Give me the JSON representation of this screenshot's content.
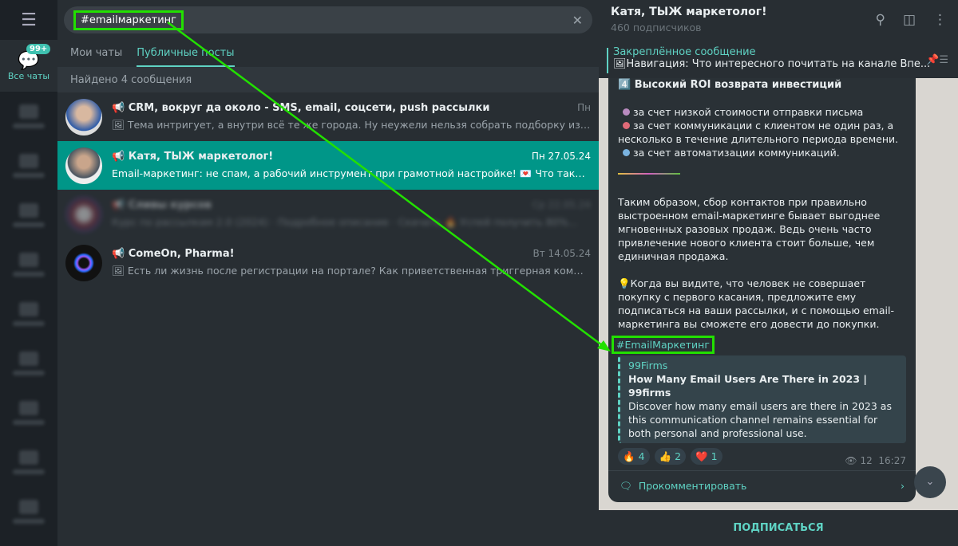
{
  "sidebar": {
    "all_chats_label": "Все чаты",
    "badge": "99+"
  },
  "search": {
    "query": "#emailмаркетинг"
  },
  "tabs": [
    {
      "label": "Мои чаты"
    },
    {
      "label": "Публичные посты"
    }
  ],
  "found": "Найдено 4 сообщения",
  "results": [
    {
      "title": "📢 CRM, вокруг да около - SMS, email, соцсети, push рассылки",
      "date": "Пн",
      "preview": "🖼 Тема интригует, а внутри всё те же города.   Ну неужели нельзя собрать подборку из чего-т..."
    },
    {
      "title": "📢 Катя, ТЫЖ маркетолог!",
      "date": "Пн 27.05.24",
      "preview": "Email-маркетинг: не спам, а рабочий инструмент при грамотной настройке! 💌  Что такое Ema..."
    },
    {
      "title": "📢 Сливы курсов",
      "date": "Ср 22.05.24",
      "preview": "Курс по рассылкам 2.0 (2024) · Подробное описание · Скачать 🔥 Успей получить 80%..."
    },
    {
      "title": "📢 ComeOn, Pharma!",
      "date": "Вт 14.05.24",
      "preview": "🖼 Есть ли жизнь после регистрации на портале?  Как приветственная триггерная коммуникац..."
    }
  ],
  "chat": {
    "name": "Катя, ТЫЖ маркетолог!",
    "subs": "460 подписчиков",
    "pinned_label": "Закреплённое сообщение",
    "pinned_text": "🖼Навигация: Что интересного почитать на канале  Впе...",
    "heading": "4️⃣ Высокий ROI возврата инвестиций",
    "b1": "за счет низкой стоимости отправки письма",
    "b2": "за счет коммуникации с клиентом не один раз, а несколько в течение длительного периода времени.",
    "b3": "за счет автоматизации коммуникаций.",
    "p1": "Таким образом, сбор контактов при правильно выстроенном email-маркетинге бывает выгоднее мгновенных разовых продаж. Ведь очень часто привлечение нового клиента стоит больше, чем единичная продажа.",
    "p2": "💡Когда вы видите, что человек не совершает покупку с первого касания, предложите ему подписаться на ваши рассылки, и с помощью email-маркетинга вы сможете его довести до покупки.",
    "hashtag": "#EmailМаркетинг",
    "link_site": "99Firms",
    "link_title": "How Many Email Users Are There in 2023 | 99firms",
    "link_desc": "Discover how many email users are there in 2023 as this communication channel remains essential for both personal and professional use.",
    "reactions": [
      {
        "e": "🔥",
        "n": "4"
      },
      {
        "e": "👍",
        "n": "2"
      },
      {
        "e": "❤️",
        "n": "1"
      }
    ],
    "views": "12",
    "time": "16:27",
    "comment": "Прокомментировать",
    "subscribe": "ПОДПИСАТЬСЯ"
  },
  "colors": {
    "accent": "#5fd3c4",
    "selected": "#009688",
    "highlight": "#22e000"
  }
}
